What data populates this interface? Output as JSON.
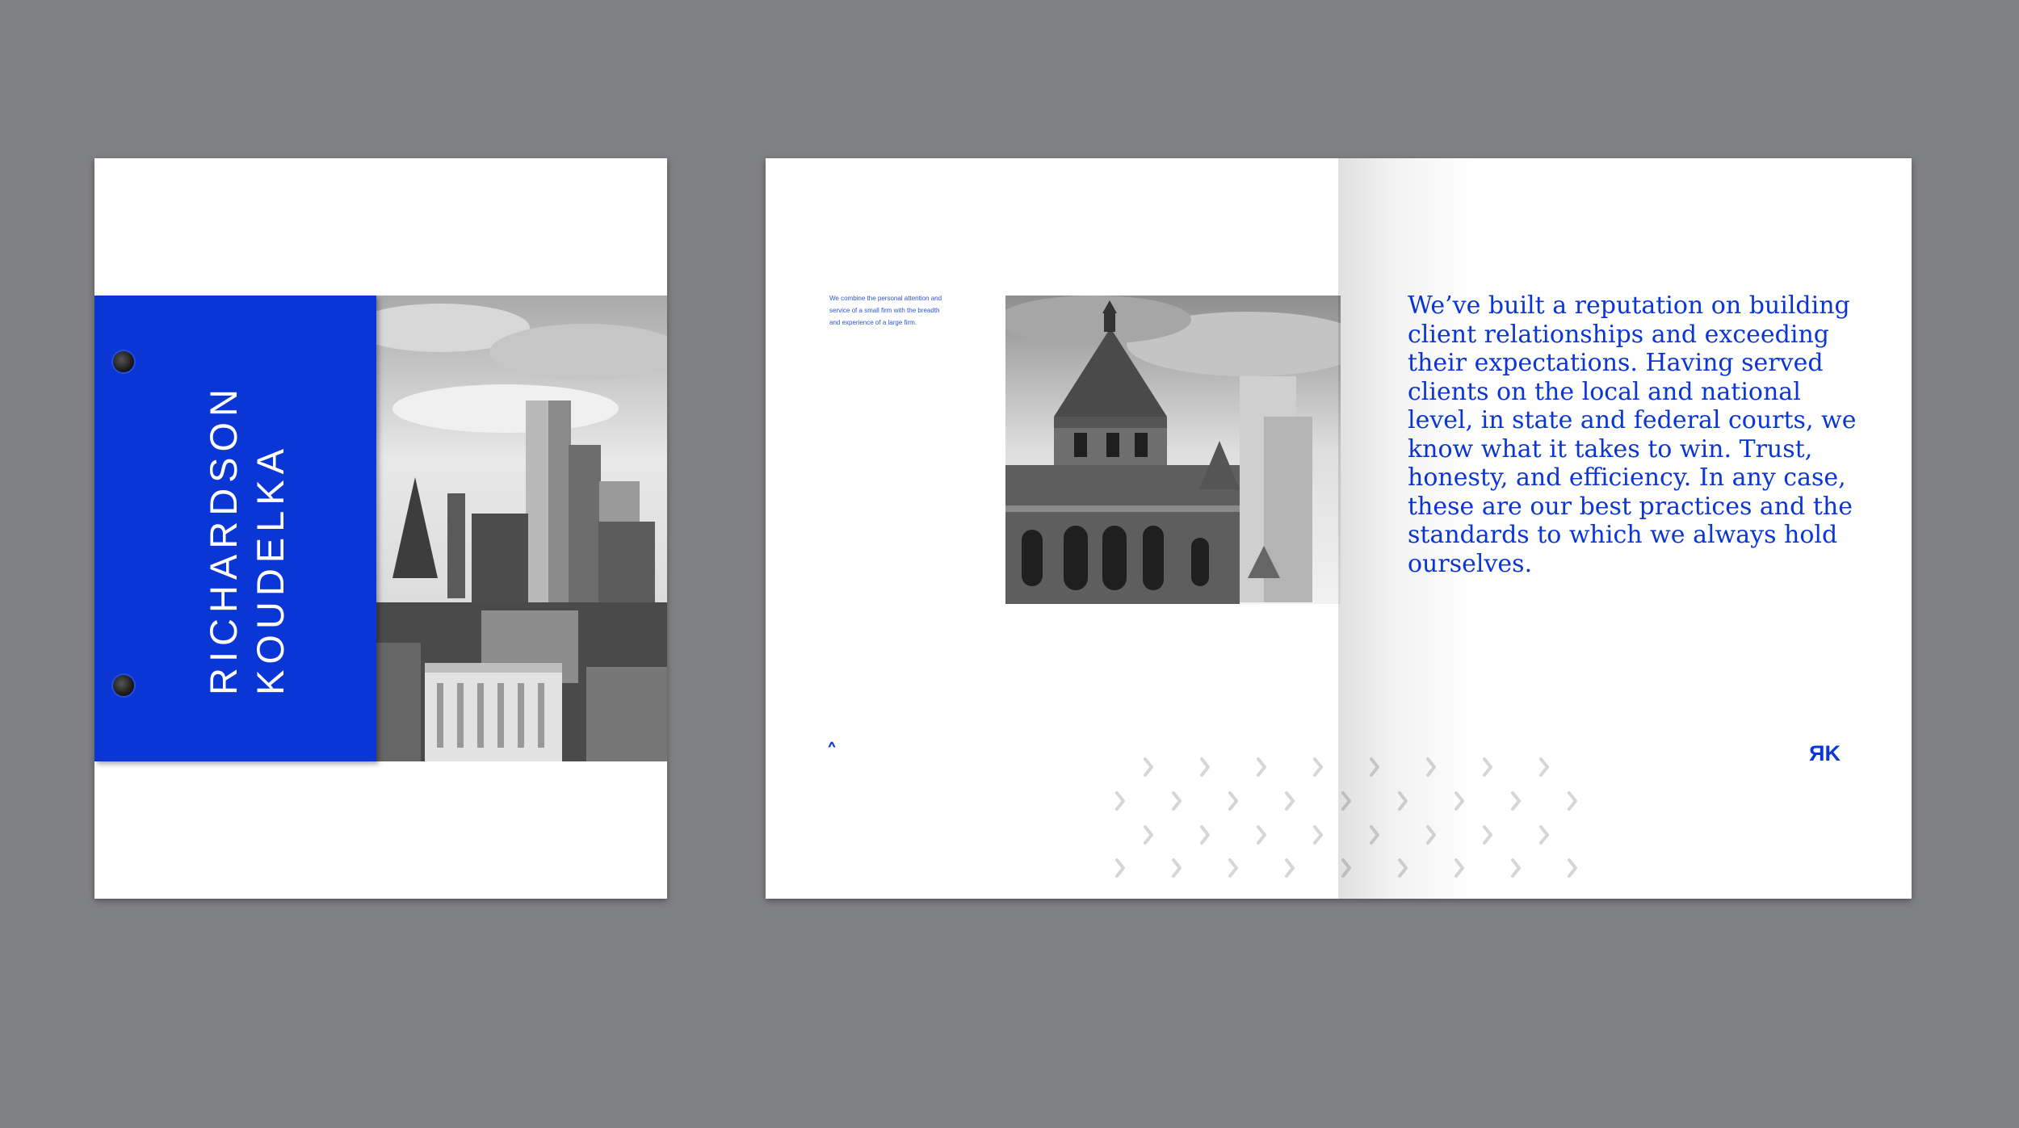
{
  "background_color": "#808184",
  "accent_color": "#0a36d6",
  "cover": {
    "title_line1": "RICHARDSON",
    "title_line2": "KOUDELKA"
  },
  "spread": {
    "small_copy": "We combine the personal attention and service of a small firm with the breadth and experience of a large firm.",
    "body_copy": "We’ve built a reputation on building client relationships and exceeding their expectations. Having served clients on the local and national level, in state and federal courts, we know what it takes to win. Trust, honesty, and efficiency. In any case, these are our best practices and the standards to which we always hold ourselves.",
    "logo_r": "R",
    "logo_k": "K",
    "caret_icon": "chevron-up-icon",
    "pattern_icon": "chevron-right-icon"
  }
}
